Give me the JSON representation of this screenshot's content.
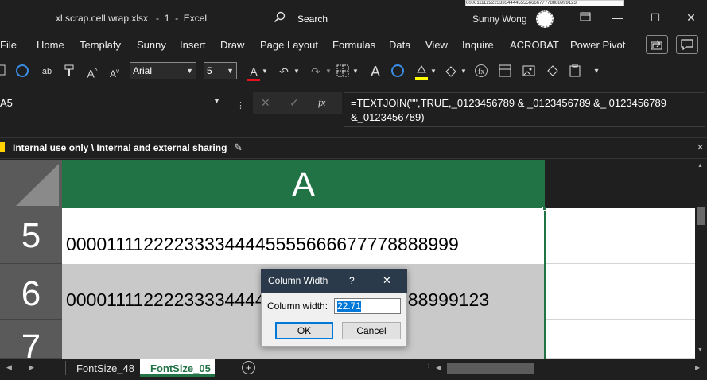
{
  "titlebar": {
    "filename": "xl.scrap.cell.wrap.xlsx",
    "separator": "-",
    "version": "1",
    "app": "Excel",
    "search_label": "Search",
    "user": "Sunny Wong",
    "thumb_text": "000011112222333344445555666677778888999123",
    "minimize": "—",
    "restore": "☐",
    "close": "✕"
  },
  "menu": {
    "items": [
      "File",
      "Home",
      "Templafy",
      "Sunny",
      "Insert",
      "Draw",
      "Page Layout",
      "Formulas",
      "Data",
      "View",
      "Inquire",
      "ACROBAT",
      "Power Pivot"
    ]
  },
  "toolbar": {
    "font_name": "Arial",
    "font_size": "5",
    "font_color_letter": "A",
    "big_a": "A"
  },
  "formula_bar": {
    "name_box": "A5",
    "fx_label": "fx",
    "formula": "=TEXTJOIN(\"\",TRUE,_0123456789 & _0123456789 &_ 0123456789 &_0123456789)"
  },
  "info_bar": {
    "text": "Internal use only \\ Internal and external sharing"
  },
  "grid": {
    "column_header": "A",
    "rows": [
      {
        "num": "5",
        "value": "000011112222333344445555666677778888999"
      },
      {
        "num": "6",
        "value": "000011112222333344445555666677778888999123"
      },
      {
        "num": "7",
        "value": ""
      }
    ]
  },
  "sheet_tabs": {
    "tabs": [
      "FontSize_48",
      "FontSize_05"
    ],
    "active": "FontSize_05",
    "add_label": "+"
  },
  "dialog": {
    "title": "Column Width",
    "help": "?",
    "close": "✕",
    "label": "Column width:",
    "value": "22.71",
    "ok": "OK",
    "cancel": "Cancel"
  },
  "colors": {
    "accent_green": "#217346",
    "dialog_title_bg": "#2b3a4a",
    "font_color_bar": "#e81123",
    "highlight_bar": "#ffff00"
  }
}
